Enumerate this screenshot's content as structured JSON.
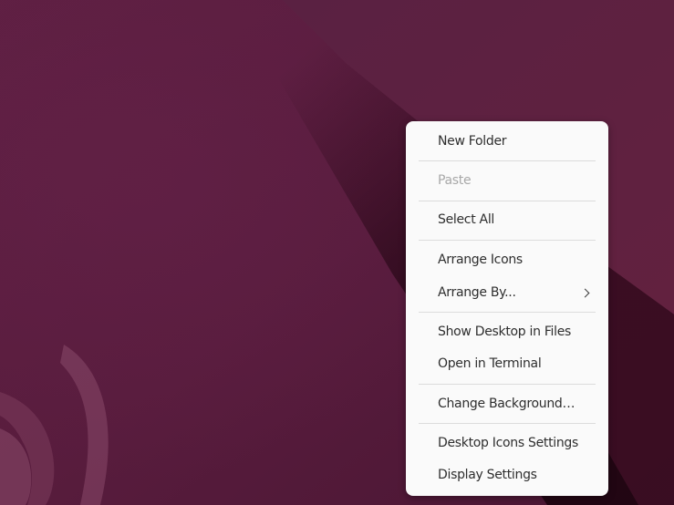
{
  "context_menu": {
    "items": [
      {
        "label": "New Folder",
        "enabled": true
      },
      {
        "label": "Paste",
        "enabled": false
      },
      {
        "label": "Select All",
        "enabled": true
      },
      {
        "label": "Arrange Icons",
        "enabled": true
      },
      {
        "label": "Arrange By...",
        "enabled": true,
        "submenu_icon": "chevron-right-icon"
      },
      {
        "label": "Show Desktop in Files",
        "enabled": true
      },
      {
        "label": "Open in Terminal",
        "enabled": true
      },
      {
        "label": "Change Background…",
        "enabled": true
      },
      {
        "label": "Desktop Icons Settings",
        "enabled": true
      },
      {
        "label": "Display Settings",
        "enabled": true
      }
    ]
  },
  "colors": {
    "wallpaper_base": "#5a1e3e",
    "menu_background": "#fafafa",
    "menu_text": "#2e2e2e",
    "menu_text_disabled": "#a8a8a8",
    "separator": "#dcdcdc"
  }
}
